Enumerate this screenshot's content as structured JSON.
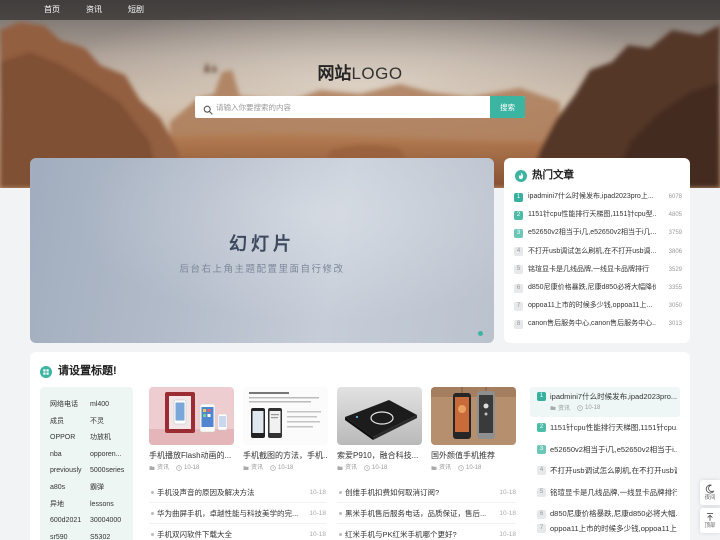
{
  "nav": {
    "items": [
      {
        "label": "首页"
      },
      {
        "label": "资讯"
      },
      {
        "label": "短剧"
      }
    ]
  },
  "logo": {
    "bold": "网站",
    "light": "LOGO"
  },
  "search": {
    "placeholder": "请输入你要搜索的内容",
    "button": "搜索"
  },
  "slider": {
    "title": "幻灯片",
    "subtitle": "后台右上角主题配置里面自行修改"
  },
  "hot": {
    "title": "热门文章",
    "items": [
      {
        "rank": "1",
        "title": "ipadmini7什么时候发布,ipad2023pro上...",
        "count": "6078"
      },
      {
        "rank": "2",
        "title": "1151针cpu性能排行天梯图,1151针cpu型...",
        "count": "4805"
      },
      {
        "rank": "3",
        "title": "e52650v2相当于i几,e52650v2相当于i几...",
        "count": "3759"
      },
      {
        "rank": "4",
        "title": "不打开usb调试怎么刷机,在不打开usb调...",
        "count": "3806"
      },
      {
        "rank": "5",
        "title": "铭瑄显卡是几线品牌,一线显卡品牌排行",
        "count": "3529"
      },
      {
        "rank": "6",
        "title": "d850尼康价格暴跌,尼康d850必将大幅降价",
        "count": "3355"
      },
      {
        "rank": "7",
        "title": "oppoa11上市的时候多少钱,oppoa11上...",
        "count": "3050"
      },
      {
        "rank": "8",
        "title": "canon售后服务中心,canon售后服务中心...",
        "count": "3013"
      }
    ]
  },
  "section": {
    "title": "请设置标题!",
    "tags": [
      "网络电话",
      "ml400",
      "成员",
      "不灵",
      "OPPOR",
      "功放机",
      "nba",
      "opporen...",
      "previously",
      "5000series",
      "a80s",
      "霸弹",
      "异地",
      "lessons",
      "600d2021",
      "30004000",
      "sr590",
      "S5302"
    ],
    "cards": [
      {
        "title": "手机播放Flash动画的...",
        "category": "资讯",
        "date": "10-18"
      },
      {
        "title": "手机截图的方法，手机...",
        "category": "资讯",
        "date": "10-18"
      },
      {
        "title": "索爱P910，融合科技...",
        "category": "资讯",
        "date": "10-18"
      },
      {
        "title": "国外颜值手机推荐",
        "category": "资讯",
        "date": "10-18"
      }
    ],
    "list_left": [
      {
        "title": "手机没声音的原因及解决方法",
        "date": "10-18"
      },
      {
        "title": "华为曲屏手机，卓越性能与科技美学的完...",
        "date": "10-18"
      },
      {
        "title": "手机双闪软件下载大全",
        "date": "10-18"
      }
    ],
    "list_right": [
      {
        "title": "创维手机扣费如何取消订阅?",
        "date": "10-18"
      },
      {
        "title": "黑米手机售后服务电话，品质保证，售后...",
        "date": "10-18"
      },
      {
        "title": "红米手机与PK红米手机哪个更好?",
        "date": "10-18"
      }
    ],
    "side_list": [
      {
        "rank": "1",
        "title": "ipadmini7什么时候发布,ipad2023pro...",
        "category": "资讯",
        "date": "10-18"
      },
      {
        "rank": "2",
        "title": "1151针cpu性能排行天梯图,1151针cpu..."
      },
      {
        "rank": "3",
        "title": "e52650v2相当于i几,e52650v2相当于i..."
      },
      {
        "rank": "4",
        "title": "不打开usb调试怎么刷机,在不打开usb调..."
      },
      {
        "rank": "5",
        "title": "铭瑄显卡是几线品牌,一线显卡品牌排行"
      },
      {
        "rank": "6",
        "title": "d850尼康价格暴跌,尼康d850必将大幅..."
      },
      {
        "rank": "7",
        "title": "oppoa11上市的时候多少钱,oppoa11上..."
      }
    ]
  },
  "float": {
    "night": "夜间",
    "top": "顶部"
  },
  "icons": {
    "search": "search-icon",
    "hot": "fire-icon",
    "section": "grid-icon",
    "category": "folder-icon",
    "date": "clock-icon",
    "night": "moon-icon",
    "top": "arrow-up-icon"
  },
  "colors": {
    "accent": "#3cb4a2",
    "page_background": "#f1f3f5",
    "rank_inactive": "#e6e8ea",
    "tag_background": "#eef6f4"
  }
}
